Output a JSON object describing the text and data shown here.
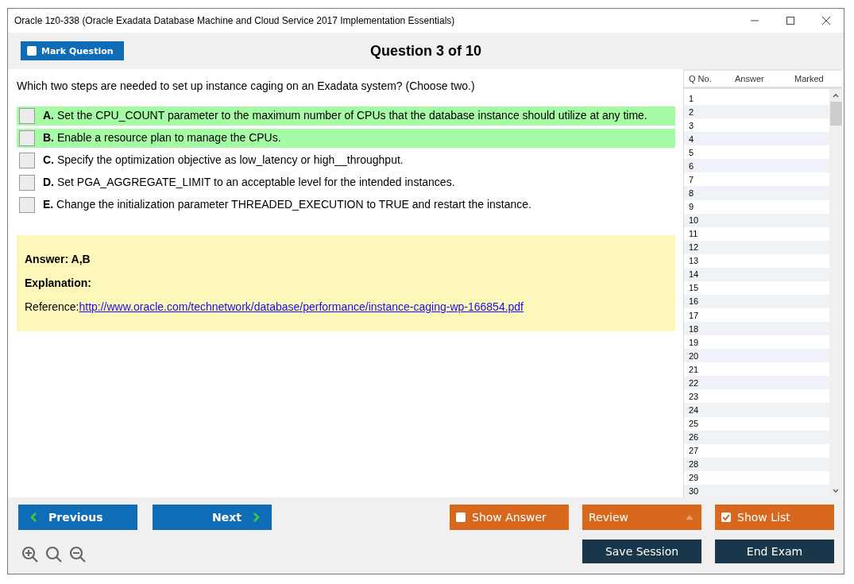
{
  "window": {
    "title": "Oracle 1z0-338 (Oracle Exadata Database Machine and Cloud Service 2017 Implementation Essentials)"
  },
  "header": {
    "mark_question": {
      "label": "Mark Question",
      "checked": false
    },
    "question_counter": "Question 3 of 10"
  },
  "question": {
    "text": "Which two steps are needed to set up instance caging on an Exadata system? (Choose two.)",
    "options": [
      {
        "letter": "A.",
        "text": "Set the CPU_COUNT parameter to the maximum number of CPUs that the database instance should utilize at any time.",
        "correct": true,
        "checked": false
      },
      {
        "letter": "B.",
        "text": "Enable a resource plan to manage the CPUs.",
        "correct": true,
        "checked": false
      },
      {
        "letter": "C.",
        "text": "Specify the optimization objective as low_latency or high__throughput.",
        "correct": false,
        "checked": false
      },
      {
        "letter": "D.",
        "text": "Set PGA_AGGREGATE_LIMIT to an acceptable level for the intended instances.",
        "correct": false,
        "checked": false
      },
      {
        "letter": "E.",
        "text": "Change the initialization parameter THREADED_EXECUTION to TRUE and restart the instance.",
        "correct": false,
        "checked": false
      }
    ]
  },
  "answer_panel": {
    "answer": "Answer: A,B",
    "explanation": "Explanation:",
    "reference_label": "Reference:",
    "reference_link": "http://www.oracle.com/technetwork/database/performance/instance-caging-wp-166854.pdf"
  },
  "question_list": {
    "columns": [
      "Q No.",
      "Answer",
      "Marked"
    ],
    "rows": [
      {
        "q": "1"
      },
      {
        "q": "2"
      },
      {
        "q": "3"
      },
      {
        "q": "4"
      },
      {
        "q": "5"
      },
      {
        "q": "6"
      },
      {
        "q": "7"
      },
      {
        "q": "8"
      },
      {
        "q": "9"
      },
      {
        "q": "10"
      },
      {
        "q": "11"
      },
      {
        "q": "12"
      },
      {
        "q": "13"
      },
      {
        "q": "14"
      },
      {
        "q": "15"
      },
      {
        "q": "16"
      },
      {
        "q": "17"
      },
      {
        "q": "18"
      },
      {
        "q": "19"
      },
      {
        "q": "20"
      },
      {
        "q": "21"
      },
      {
        "q": "22"
      },
      {
        "q": "23"
      },
      {
        "q": "24"
      },
      {
        "q": "25"
      },
      {
        "q": "26"
      },
      {
        "q": "27"
      },
      {
        "q": "28"
      },
      {
        "q": "29"
      },
      {
        "q": "30"
      }
    ]
  },
  "footer": {
    "previous": "Previous",
    "next": "Next",
    "show_answer": {
      "label": "Show Answer",
      "checked": false
    },
    "review": "Review",
    "show_list": {
      "label": "Show List",
      "checked": true
    },
    "save_session": "Save Session",
    "end_exam": "End Exam"
  }
}
